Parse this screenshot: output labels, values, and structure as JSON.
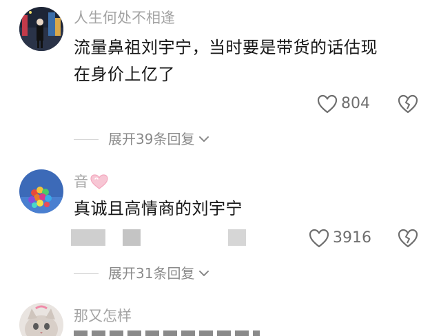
{
  "comments": [
    {
      "username": "人生何处不相逢",
      "text_line1": "流量鼻祖刘宇宁，当时要是带货的话估现",
      "text_line2": "在身价上亿了",
      "likes": "804",
      "replies_label": "展开39条回复"
    },
    {
      "username": "音",
      "username_badge": "heart-badge-icon",
      "text_line1": "真诚且高情商的刘宇宁",
      "likes": "3916",
      "replies_label": "展开31条回复"
    },
    {
      "username": "那又怎样"
    }
  ],
  "colors": {
    "username": "#a3a3a3",
    "content": "#161616",
    "meta": "#6e6e6e",
    "badge_pink": "#f7b6c8"
  }
}
